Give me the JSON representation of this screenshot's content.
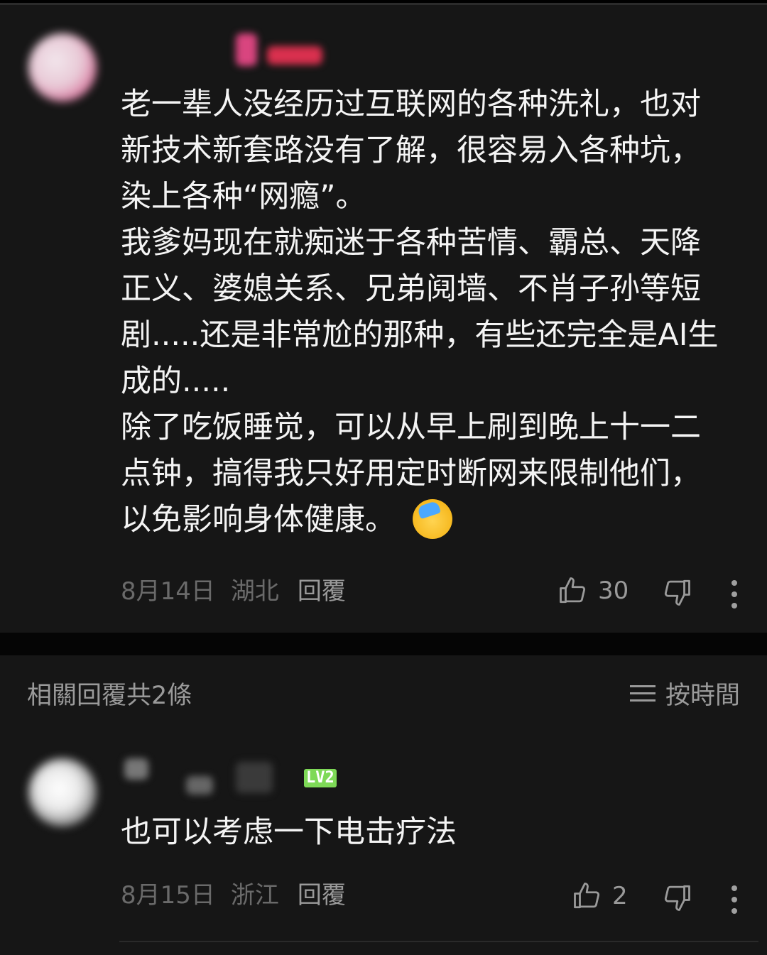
{
  "comment": {
    "lines": [
      "老一辈人没经历过互联网的各种洗礼，也对",
      "新技术新套路没有了解，很容易入各种坑，",
      "染上各种“网瘾”。",
      "我爹妈现在就痴迷于各种苦情、霸总、天降",
      "正义、婆媳关系、兄弟阋墙、不肖子孙等短",
      "剧.....还是非常尬的那种，有些还完全是AI生",
      "成的.....",
      "除了吃饭睡觉，可以从早上刷到晚上十一二",
      "点钟，搞得我只好用定时断网来限制他们，",
      "以免影响身体健康。"
    ],
    "emoji": "laughing-crying-emoji",
    "date": "8月14日",
    "location": "湖北",
    "reply_label": "回覆",
    "like_count": "30"
  },
  "replies_section": {
    "header": "相關回覆共2條",
    "sort_label": "按時間"
  },
  "reply": {
    "badge": "LV2",
    "text": "也可以考虑一下电击疗法",
    "date": "8月15日",
    "location": "浙江",
    "reply_label": "回覆",
    "like_count": "2"
  },
  "colors": {
    "background": "#161616",
    "text": "#f4f4f4",
    "meta": "#6a6a6a",
    "badge": "#7ed957"
  }
}
